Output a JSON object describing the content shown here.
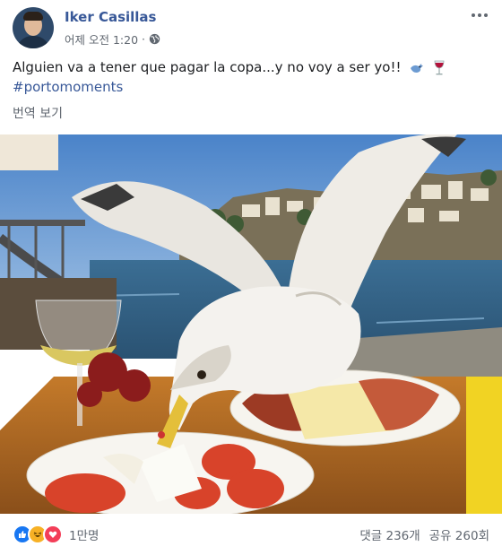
{
  "author": {
    "name": "Iker Casillas",
    "timestamp": "어제 오전 1:20",
    "separator": "·",
    "privacy_icon": "globe-icon"
  },
  "post": {
    "text": "Alguien va a tener que pagar la copa...y no voy a ser yo!!",
    "emojis": [
      "bird-emoji",
      "wine-glass-emoji"
    ],
    "hashtag": "#portomoments",
    "translate_label": "번역 보기"
  },
  "photo": {
    "description_icon": "seagull-photo"
  },
  "footer": {
    "reaction_icons": [
      "like-icon",
      "haha-icon",
      "love-icon"
    ],
    "reaction_count": "1만명",
    "comments": "댓글 236개",
    "shares": "공유 260회"
  },
  "colors": {
    "link": "#385898",
    "secondary_text": "#606770",
    "like": "#1877f2",
    "haha": "#f7b125",
    "love": "#f33e58"
  }
}
